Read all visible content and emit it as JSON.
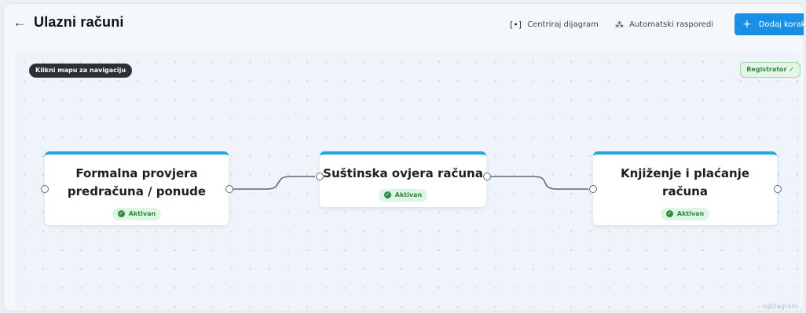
{
  "header": {
    "back_icon": "arrow-left-icon",
    "title": "Ulazni računi",
    "center_label": "Centriraj dijagram",
    "auto_label": "Automatski rasporedi",
    "add_label": "Dodaj korak"
  },
  "canvas": {
    "nav_hint": "Klikni mapu za navigaciju",
    "registrator_label": "Registrator ✓",
    "watermark": "ngDiagram"
  },
  "nodes": [
    {
      "title_line1": "Formalna provjera",
      "title_line2": "predračuna / ponude",
      "status": "Aktivan"
    },
    {
      "title_line1": "Suštinska ovjera računa",
      "status": "Aktivan"
    },
    {
      "title_line1": "Knjiženje i plaćanje",
      "title_line2": "računa",
      "status": "Aktivan"
    }
  ],
  "colors": {
    "accent": "#1a8fe6",
    "node_top_border": "#22a6e0",
    "status_green": "#2b8a3e"
  }
}
